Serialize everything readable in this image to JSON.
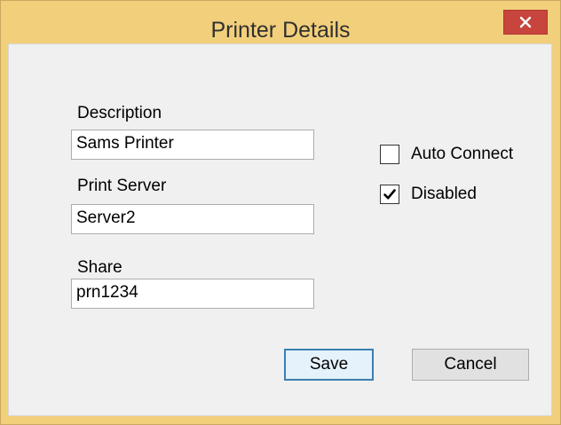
{
  "window": {
    "title": "Printer Details",
    "close_icon": "close-icon"
  },
  "form": {
    "description": {
      "label": "Description",
      "value": "Sams Printer"
    },
    "print_server": {
      "label": "Print Server",
      "value": "Server2"
    },
    "share": {
      "label": "Share",
      "value": "prn1234"
    },
    "auto_connect": {
      "label": "Auto Connect",
      "checked": false
    },
    "disabled": {
      "label": "Disabled",
      "checked": true
    }
  },
  "buttons": {
    "save_label": "Save",
    "cancel_label": "Cancel"
  },
  "colors": {
    "frame": "#f2cf7b",
    "close_button": "#c7453c",
    "client_bg": "#f0f0f0",
    "default_button_border": "#3c7fb1"
  }
}
